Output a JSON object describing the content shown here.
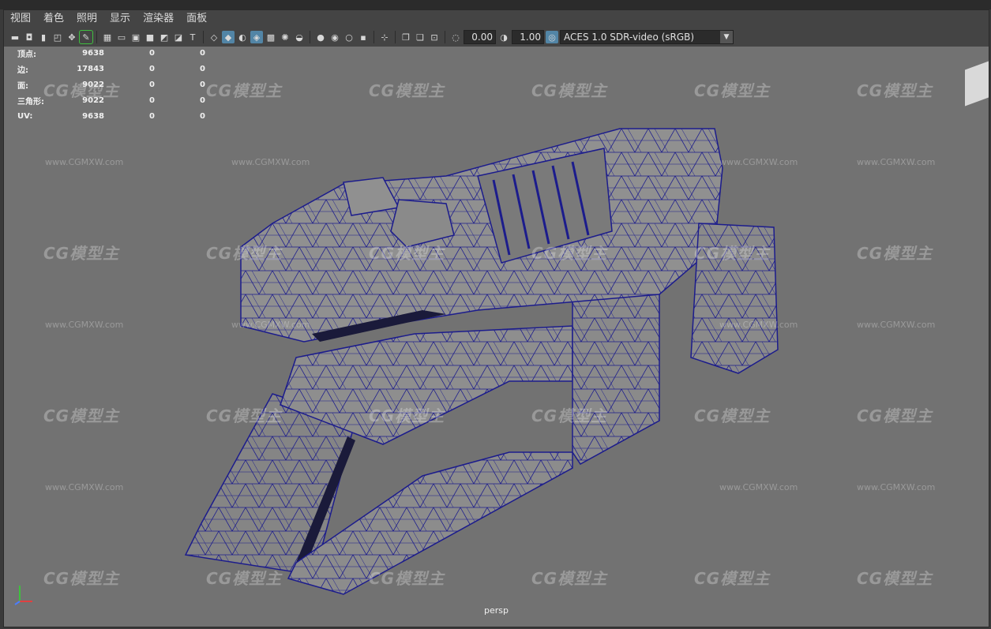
{
  "menu": [
    "视图",
    "着色",
    "照明",
    "显示",
    "渲染器",
    "面板"
  ],
  "toolbar": {
    "exposure_value": "0.00",
    "gamma_value": "1.00",
    "color_space": "ACES 1.0 SDR-video (sRGB)"
  },
  "hud": {
    "rows": [
      {
        "label": "顶点:",
        "value": "9638",
        "sel": "0",
        "comp": "0"
      },
      {
        "label": "边:",
        "value": "17843",
        "sel": "0",
        "comp": "0"
      },
      {
        "label": "面:",
        "value": "9022",
        "sel": "0",
        "comp": "0"
      },
      {
        "label": "三角形:",
        "value": "9022",
        "sel": "0",
        "comp": "0"
      },
      {
        "label": "UV:",
        "value": "9638",
        "sel": "0",
        "comp": "0"
      }
    ]
  },
  "watermark": {
    "logo": "CG模型主",
    "url": "www.CGMXW.com"
  },
  "camera_name": "persp",
  "colors": {
    "viewport_bg": "#727272",
    "wire": "#1c1c8c",
    "mesh": "#8a8a8a",
    "active_icon": "#5285a6"
  }
}
